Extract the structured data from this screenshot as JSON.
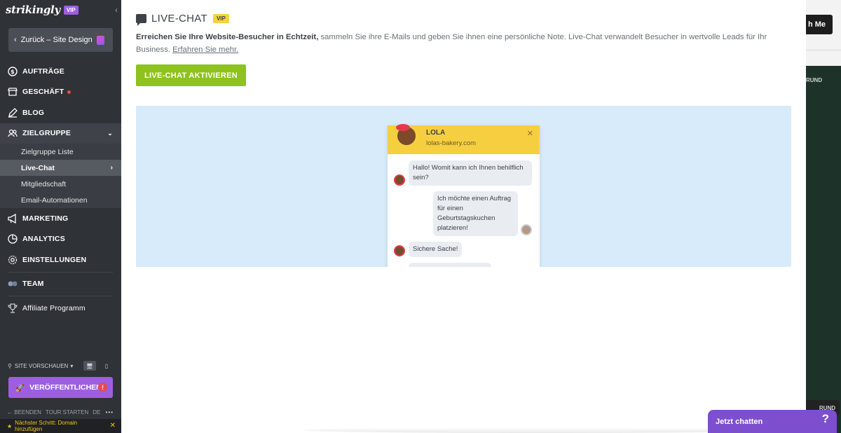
{
  "sidebar": {
    "logo": "strikingly",
    "vip": "VIP",
    "back_label": "Zurück – Site Design",
    "items": [
      {
        "label": "AUFTRÄGE",
        "icon": "dollar-icon"
      },
      {
        "label": "GESCHÄFT",
        "icon": "store-icon",
        "has_dot": true
      },
      {
        "label": "BLOG",
        "icon": "pen-icon"
      },
      {
        "label": "ZIELGRUPPE",
        "icon": "audience-icon",
        "expanded": true
      },
      {
        "label": "MARKETING",
        "icon": "megaphone-icon"
      },
      {
        "label": "ANALYTICS",
        "icon": "pie-chart-icon"
      },
      {
        "label": "EINSTELLUNGEN",
        "icon": "gear-icon"
      },
      {
        "label": "TEAM",
        "icon": "team-icon"
      },
      {
        "label": "Affiliate Programm",
        "icon": "trophy-icon"
      }
    ],
    "subitems": [
      "Zielgruppe Liste",
      "Live-Chat",
      "Mitgliedschaft",
      "Email-Automationen"
    ],
    "active_subitem": "Live-Chat",
    "preview_label": "SITE VORSCHAUEN",
    "publish_label": "VERÖFFENTLICHEN",
    "publish_warning": "!",
    "footer": {
      "exit": "BEENDEN",
      "tour": "TOUR STARTEN",
      "lang": "DE"
    },
    "next_step": "Nächster Schritt: Domain hinzufügen"
  },
  "panel": {
    "title": "LIVE-CHAT",
    "vip_tag": "VIP",
    "desc_bold": "Erreichen Sie Ihre Website-Besucher in Echtzeit,",
    "desc_text": " sammeln Sie ihre E-Mails und geben Sie ihnen eine persönliche Note. Live-Chat verwandelt Besucher in wertvolle Leads für Ihr Business. ",
    "learn_more": "Erfahren Sie mehr.",
    "activate_label": "LIVE-CHAT AKTIVIEREN"
  },
  "chat_preview": {
    "name": "LOLA",
    "site": "lolas-bakery.com",
    "messages": [
      {
        "from": "bot",
        "text": "Hallo! Womit kann ich Ihnen behilflich sein?"
      },
      {
        "from": "user",
        "text": "Ich möchte einen Auftrag für einen Geburtstagskuchen platzieren!"
      },
      {
        "from": "bot",
        "text": "Sichere Sache!"
      }
    ]
  },
  "right_bg": {
    "button_label": "h Me",
    "label_top": "RUND",
    "label_bottom": "RUND"
  },
  "chat_widget": {
    "label": "Jetzt chatten",
    "help": "?"
  }
}
